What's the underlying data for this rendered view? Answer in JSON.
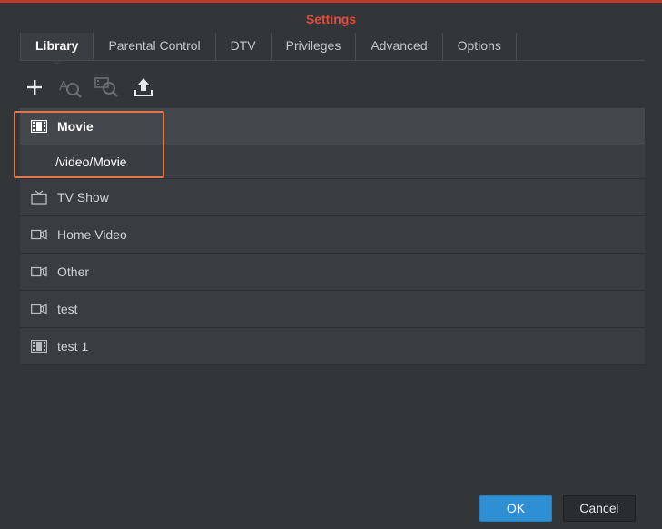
{
  "dialog": {
    "title": "Settings",
    "accent_color": "#e24b3b"
  },
  "tabs": [
    {
      "label": "Library",
      "active": true
    },
    {
      "label": "Parental Control",
      "active": false
    },
    {
      "label": "DTV",
      "active": false
    },
    {
      "label": "Privileges",
      "active": false
    },
    {
      "label": "Advanced",
      "active": false
    },
    {
      "label": "Options",
      "active": false
    }
  ],
  "toolbar": {
    "items": [
      {
        "name": "add-icon",
        "enabled": true
      },
      {
        "name": "scan-library-icon",
        "enabled": false
      },
      {
        "name": "scan-media-icon",
        "enabled": false
      },
      {
        "name": "upload-icon",
        "enabled": true
      }
    ]
  },
  "library": {
    "items": [
      {
        "label": "Movie",
        "icon": "film-icon",
        "selected": true
      },
      {
        "label": "/video/Movie",
        "icon": "",
        "subrow": true
      },
      {
        "label": "TV Show",
        "icon": "tv-icon"
      },
      {
        "label": "Home Video",
        "icon": "video-camera-icon"
      },
      {
        "label": "Other",
        "icon": "video-camera-icon"
      },
      {
        "label": "test",
        "icon": "video-camera-icon"
      },
      {
        "label": "test 1",
        "icon": "film-icon"
      }
    ]
  },
  "footer": {
    "ok_label": "OK",
    "cancel_label": "Cancel",
    "ok_color": "#2f8fd4"
  }
}
